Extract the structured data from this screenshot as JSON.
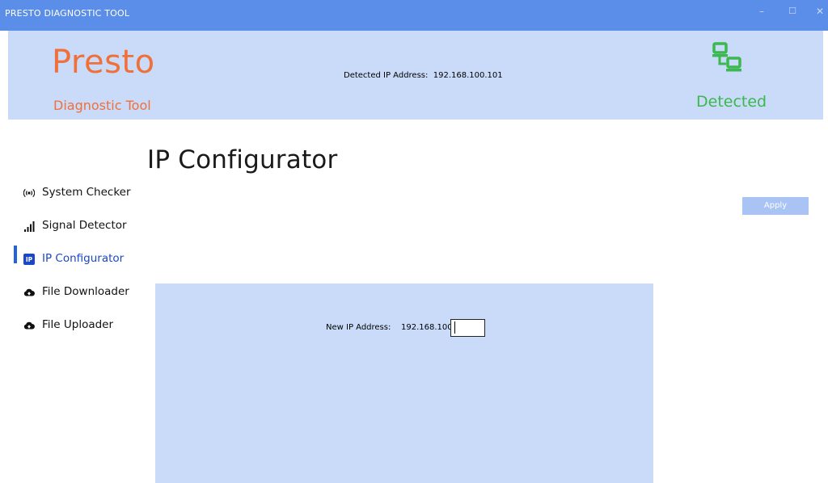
{
  "window": {
    "title": "PRESTO DIAGNOSTIC TOOL",
    "controls": {
      "minimize": "–",
      "maximize": "☐",
      "close": "✕"
    }
  },
  "header": {
    "brand": "Presto",
    "subtitle": "Diagnostic Tool",
    "detected_ip_label": "Detected IP Address:",
    "detected_ip_value": "192.168.100.101",
    "status": "Detected",
    "status_icon": "network-connected-icon",
    "colors": {
      "brand": "#f0703a",
      "status": "#3bb84e",
      "banner_bg": "#c9dbf9",
      "titlebar_bg": "#5b8ee8"
    }
  },
  "sidebar": {
    "items": [
      {
        "label": "System Checker",
        "icon": "broadcast-icon"
      },
      {
        "label": "Signal Detector",
        "icon": "signal-bars-icon"
      },
      {
        "label": "IP Configurator",
        "icon": "ip-icon",
        "active": true
      },
      {
        "label": "File Downloader",
        "icon": "cloud-icon"
      },
      {
        "label": "File Uploader",
        "icon": "cloud-icon"
      }
    ],
    "accent": "#2563d9"
  },
  "main": {
    "title": "IP Configurator",
    "apply_label": "Apply",
    "form": {
      "label": "New IP Address:",
      "prefix": "192.168.100.",
      "value": ""
    }
  }
}
